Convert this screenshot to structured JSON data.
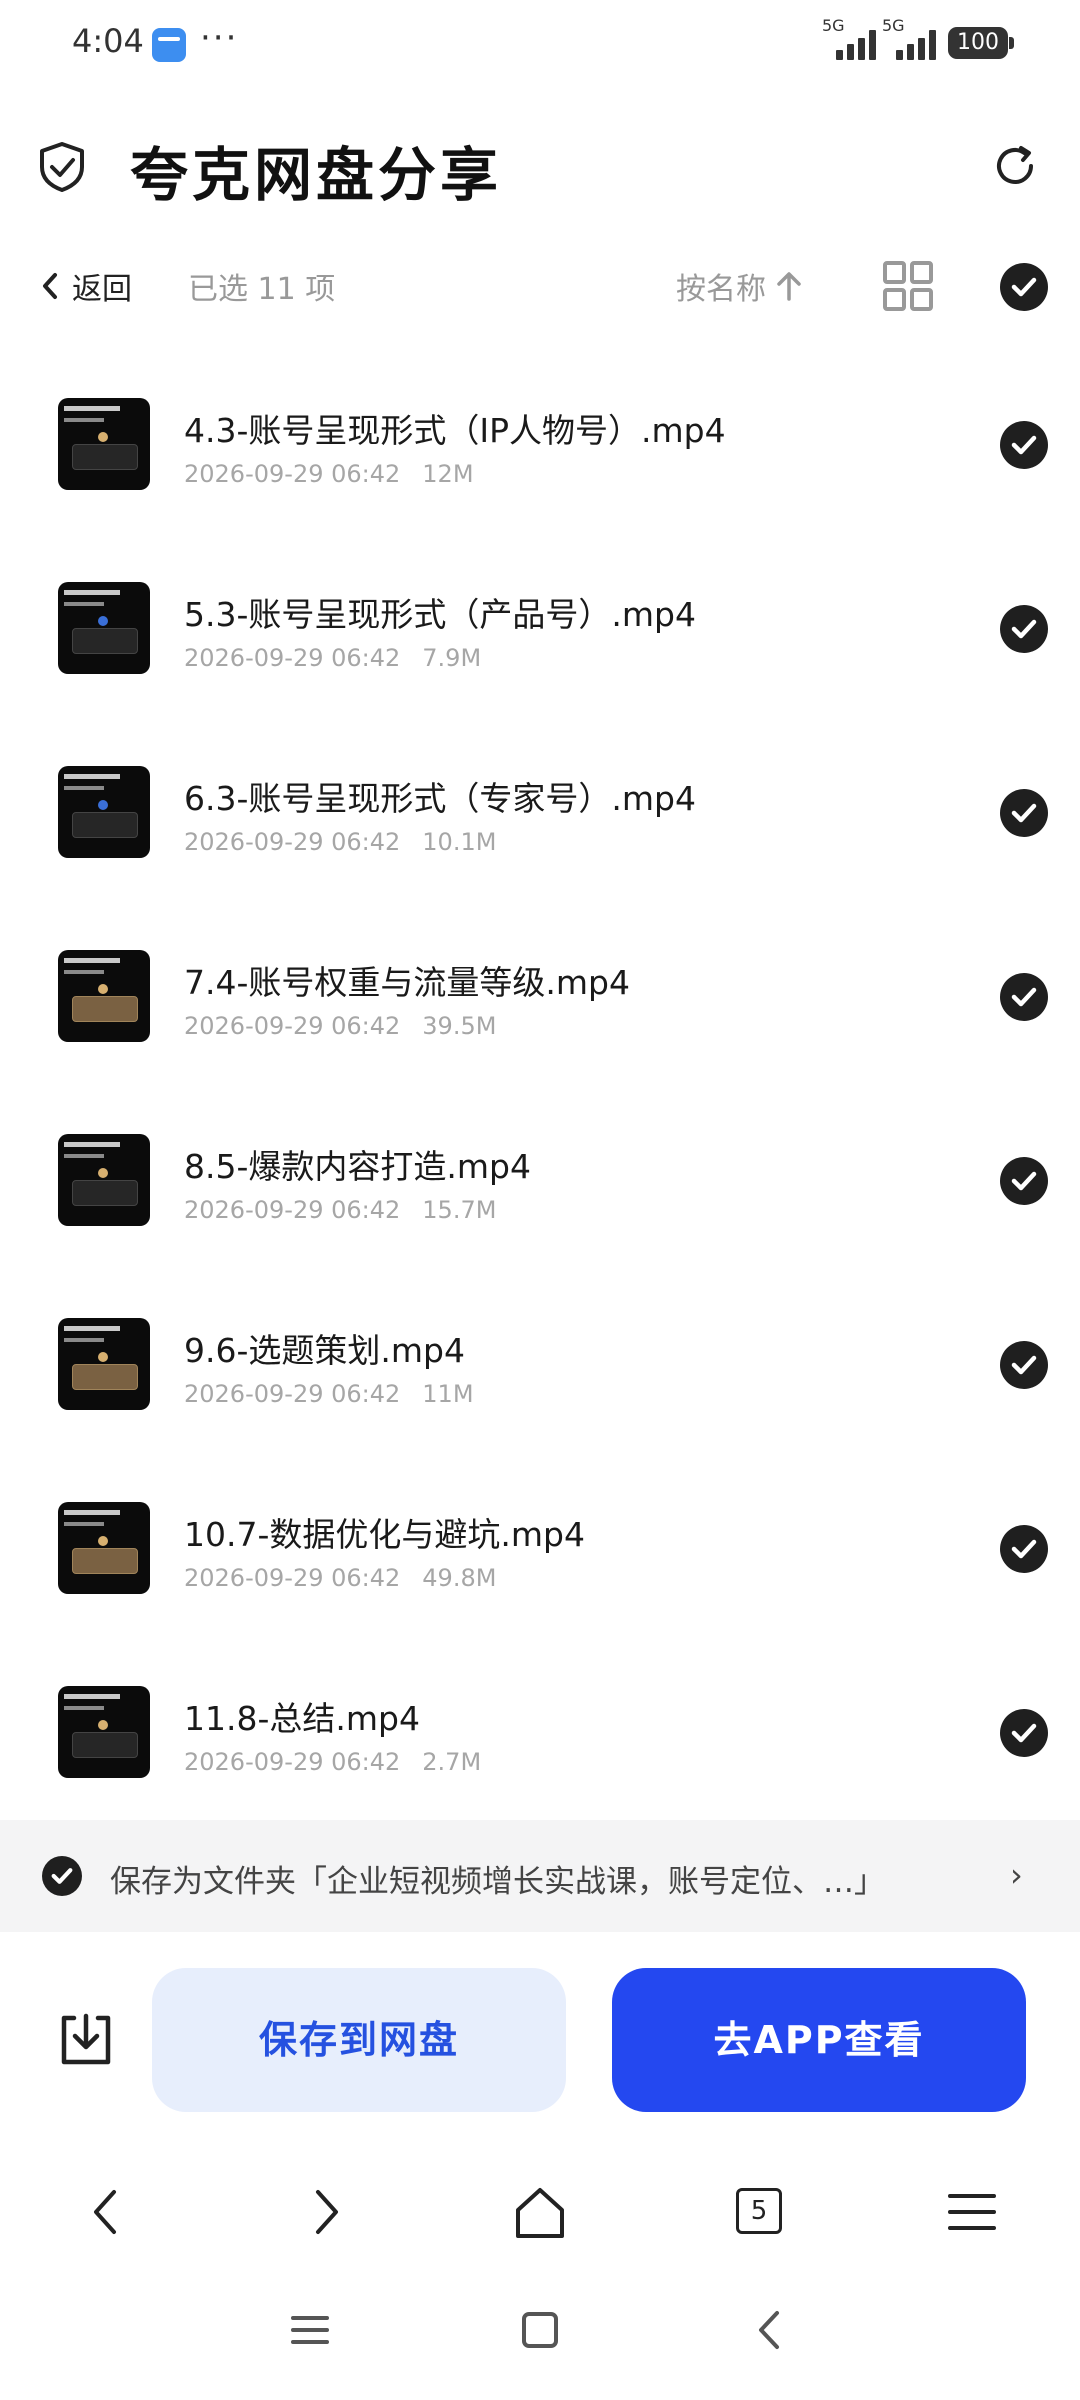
{
  "status_bar": {
    "time": "4:04",
    "dots": "···",
    "signal_1": "5G",
    "signal_2": "5G",
    "battery": "100"
  },
  "header": {
    "title": "夸克网盘分享",
    "left_icon": "shield-check-icon",
    "right_icon": "refresh-icon"
  },
  "toolbar": {
    "back_label": "返回",
    "selected_label": "已选 11 项",
    "sort_label": "按名称",
    "view_icon": "grid-view-icon",
    "select_all_icon": "check-circle-icon"
  },
  "files": [
    {
      "name": "4.3-账号呈现形式（IP人物号）.mp4",
      "date": "2026-09-29 06:42",
      "size": "12M"
    },
    {
      "name": "5.3-账号呈现形式（产品号）.mp4",
      "date": "2026-09-29 06:42",
      "size": "7.9M"
    },
    {
      "name": "6.3-账号呈现形式（专家号）.mp4",
      "date": "2026-09-29 06:42",
      "size": "10.1M"
    },
    {
      "name": "7.4-账号权重与流量等级.mp4",
      "date": "2026-09-29 06:42",
      "size": "39.5M"
    },
    {
      "name": "8.5-爆款内容打造.mp4",
      "date": "2026-09-29 06:42",
      "size": "15.7M"
    },
    {
      "name": "9.6-选题策划.mp4",
      "date": "2026-09-29 06:42",
      "size": "11M"
    },
    {
      "name": "10.7-数据优化与避坑.mp4",
      "date": "2026-09-29 06:42",
      "size": "49.8M"
    },
    {
      "name": "11.8-总结.mp4",
      "date": "2026-09-29 06:42",
      "size": "2.7M"
    }
  ],
  "folder_bar": {
    "text": "保存为文件夹「企业短视频增长实战课，账号定位、…」",
    "chevron": "›"
  },
  "actions": {
    "save_label": "保存到网盘",
    "open_app_label": "去APP查看"
  },
  "browser_nav": {
    "tab_count": "5"
  },
  "colors": {
    "primary": "#2448f0",
    "save_bg": "#e7eefc",
    "save_text": "#2551e0",
    "check": "#1f1f1f"
  }
}
